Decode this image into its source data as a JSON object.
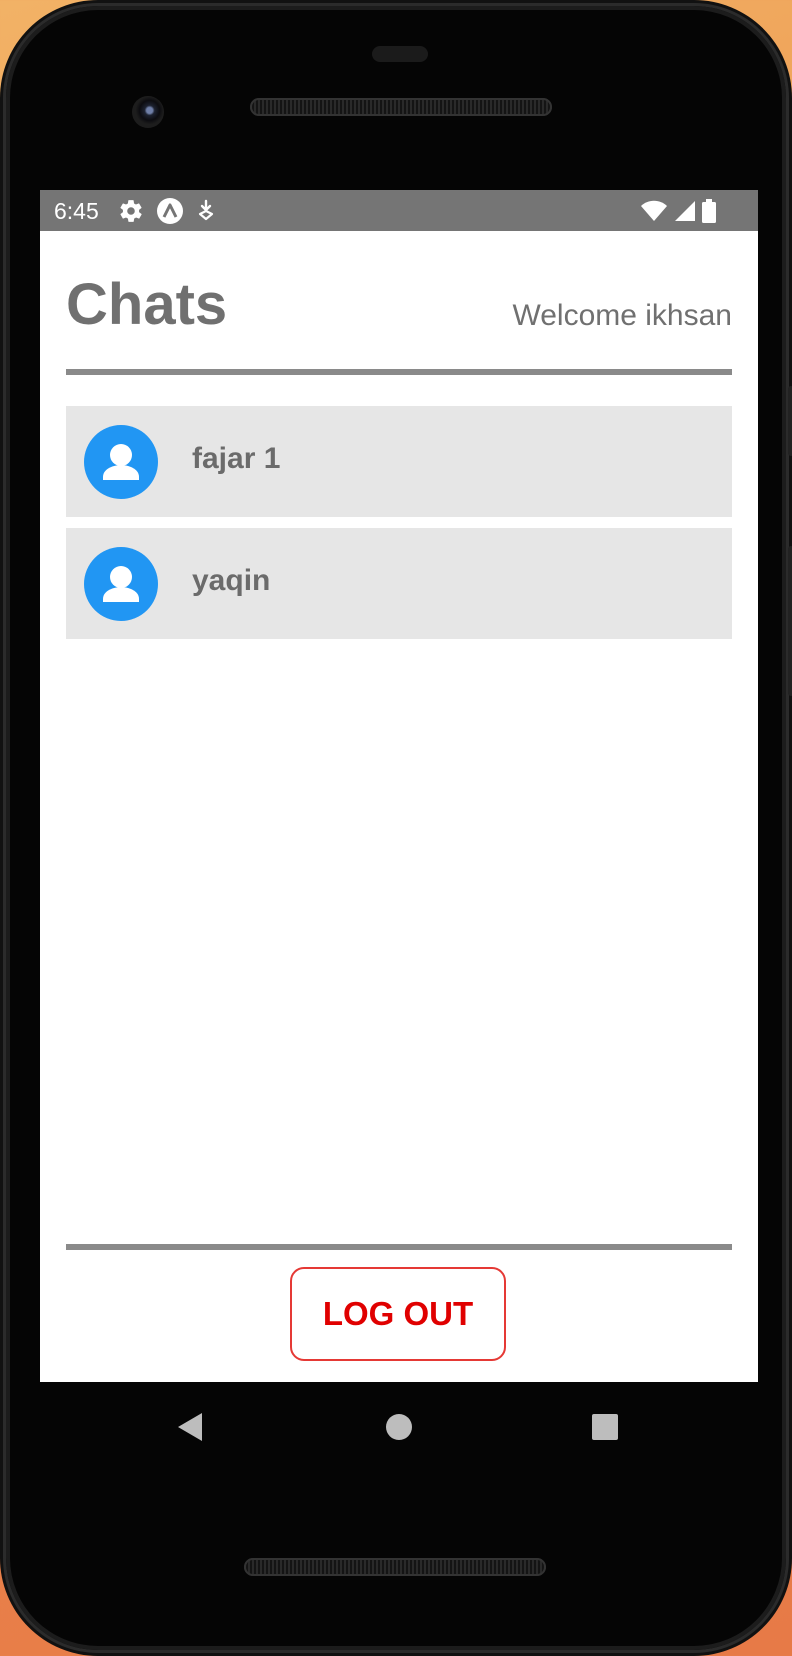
{
  "status_bar": {
    "time": "6:45",
    "left_icons": [
      "gear-icon",
      "autofill-icon",
      "download-icon"
    ],
    "right_icons": [
      "wifi-icon",
      "signal-icon",
      "battery-icon"
    ]
  },
  "header": {
    "title": "Chats",
    "welcome": "Welcome ikhsan"
  },
  "chats": [
    {
      "name": "fajar 1",
      "avatar_icon": "person-icon"
    },
    {
      "name": "yaqin",
      "avatar_icon": "person-icon"
    }
  ],
  "footer": {
    "logout_label": "LOG OUT"
  },
  "nav_bar": {
    "buttons": [
      "back-icon",
      "home-icon",
      "recents-icon"
    ]
  },
  "colors": {
    "status_bar": "#757575",
    "avatar": "#2196f3",
    "list_item": "#e6e6e6",
    "divider": "#8a8a8a",
    "logout": "#e00000"
  }
}
